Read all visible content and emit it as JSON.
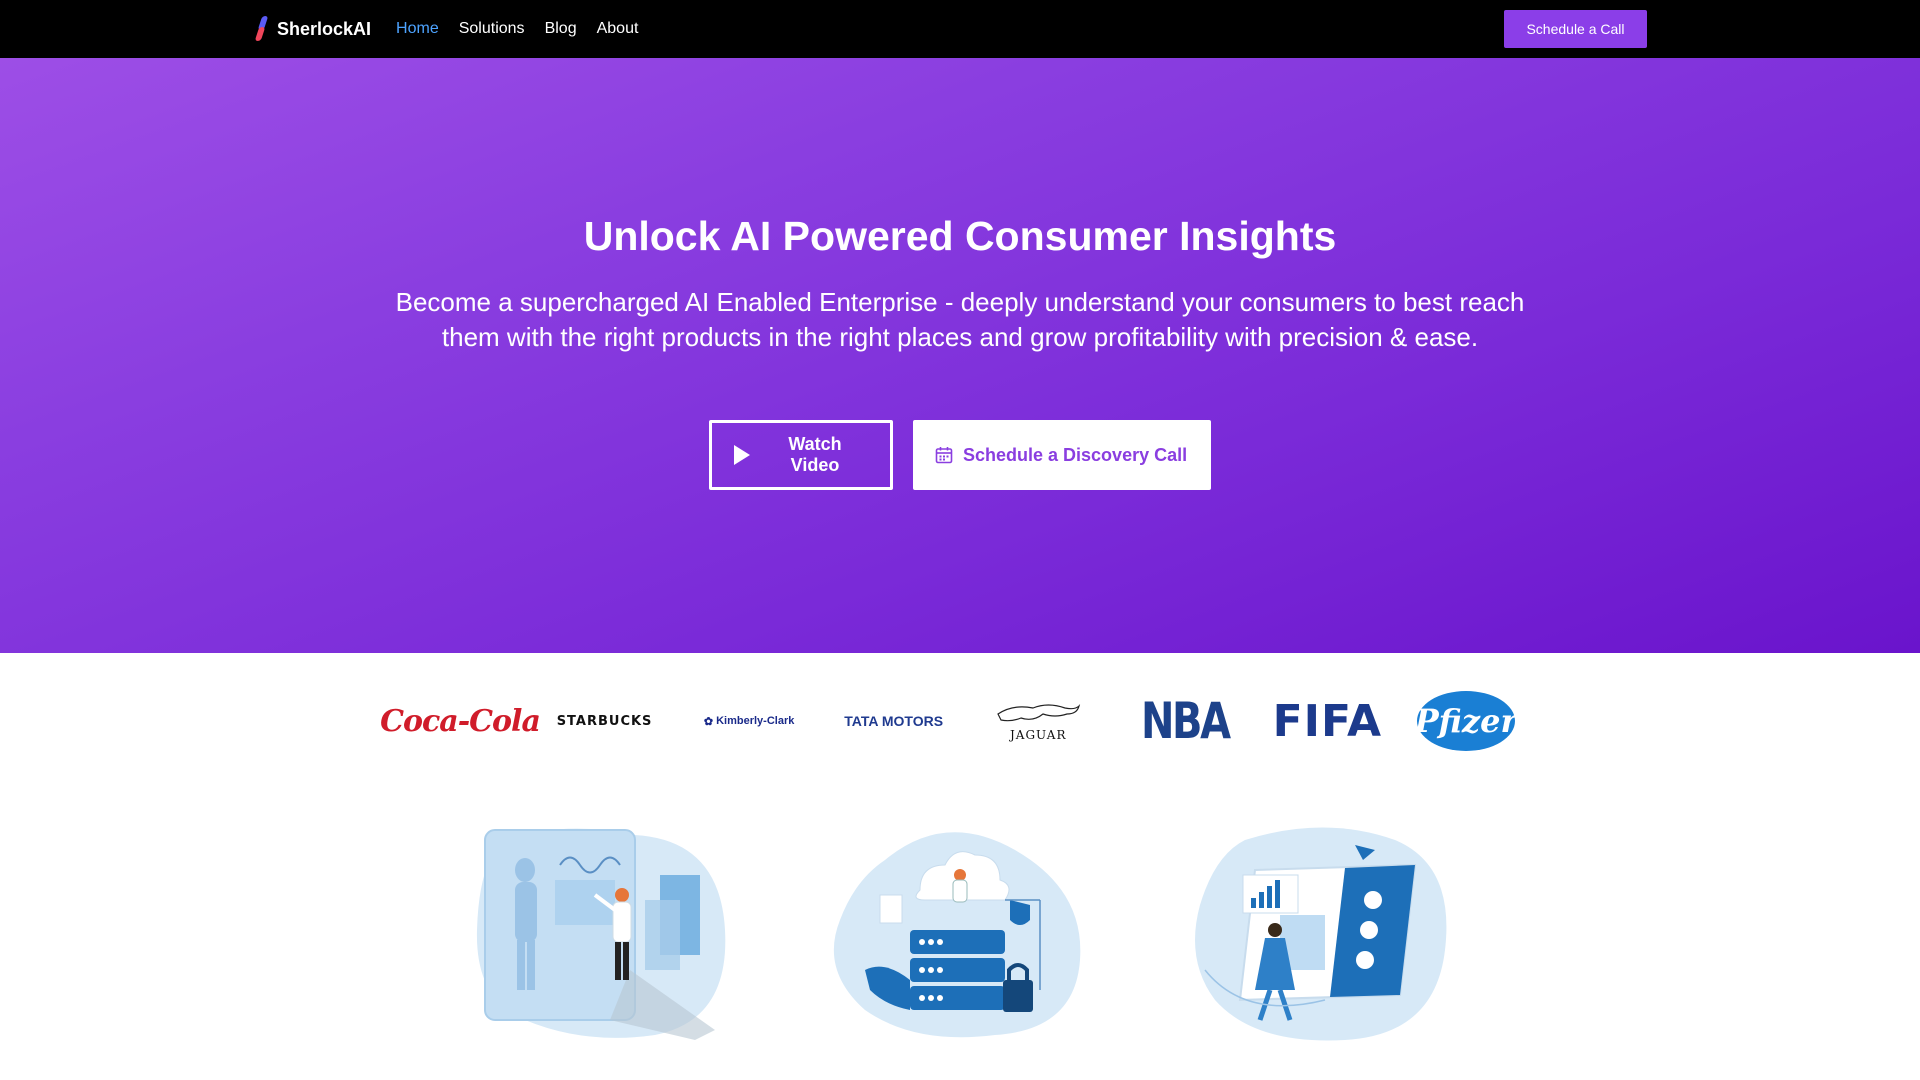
{
  "nav": {
    "brand": "SherlockAI",
    "links": [
      "Home",
      "Solutions",
      "Blog",
      "About"
    ],
    "cta_label": "Schedule a Call",
    "active_color": "#4da3ff"
  },
  "hero": {
    "title": "Unlock AI Powered Consumer Insights",
    "subtitle": "Become a supercharged AI Enabled Enterprise - deeply understand your consumers to best reach them with the right products in the right places and grow profitability with precision & ease.",
    "watch_label": "Watch Video",
    "discovery_label": "Schedule a Discovery Call",
    "gradient": [
      "#9d4ee6",
      "#6a14cc"
    ]
  },
  "logos": {
    "coke": "Coca-Cola",
    "starbucks": "STARBUCKS",
    "kimberly": "Kimberly-Clark",
    "tata": "TATA MOTORS",
    "jaguar": "JAGUAR",
    "nba": "NBA",
    "fifa": "FIFA",
    "pfizer": "Pfizer"
  },
  "illustrations": [
    "scientist-illustration",
    "cloud-server-illustration",
    "dashboard-illustration"
  ]
}
